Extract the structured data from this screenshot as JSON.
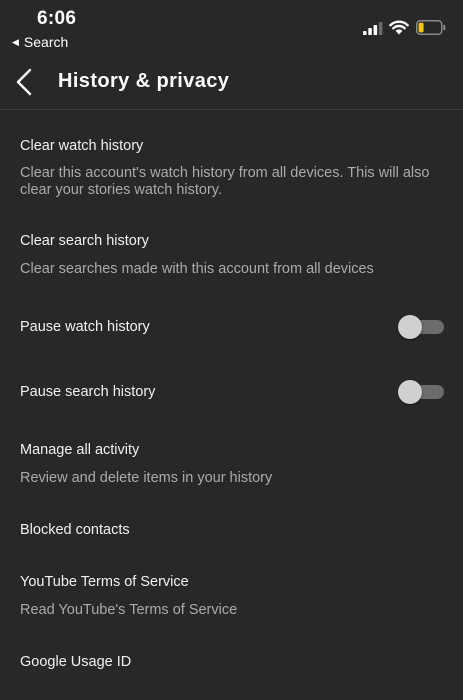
{
  "status_bar": {
    "time": "6:06",
    "back_app_label": "Search"
  },
  "header": {
    "title": "History & privacy"
  },
  "items": [
    {
      "title": "Clear watch history",
      "subtitle": "Clear this account's watch history from all devices. This will also clear your stories watch history."
    },
    {
      "title": "Clear search history",
      "subtitle": "Clear searches made with this account from all devices"
    },
    {
      "title": "Pause watch history",
      "toggle_on": false
    },
    {
      "title": "Pause search history",
      "toggle_on": false
    },
    {
      "title": "Manage all activity",
      "subtitle": "Review and delete items in your history"
    },
    {
      "title": "Blocked contacts"
    },
    {
      "title": "YouTube Terms of Service",
      "subtitle": "Read YouTube's Terms of Service"
    },
    {
      "title": "Google Usage ID"
    }
  ],
  "colors": {
    "background": "#282828",
    "primary_text": "#f1f1f1",
    "secondary_text": "#aaaaaa",
    "battery_level": "#f5c518"
  }
}
